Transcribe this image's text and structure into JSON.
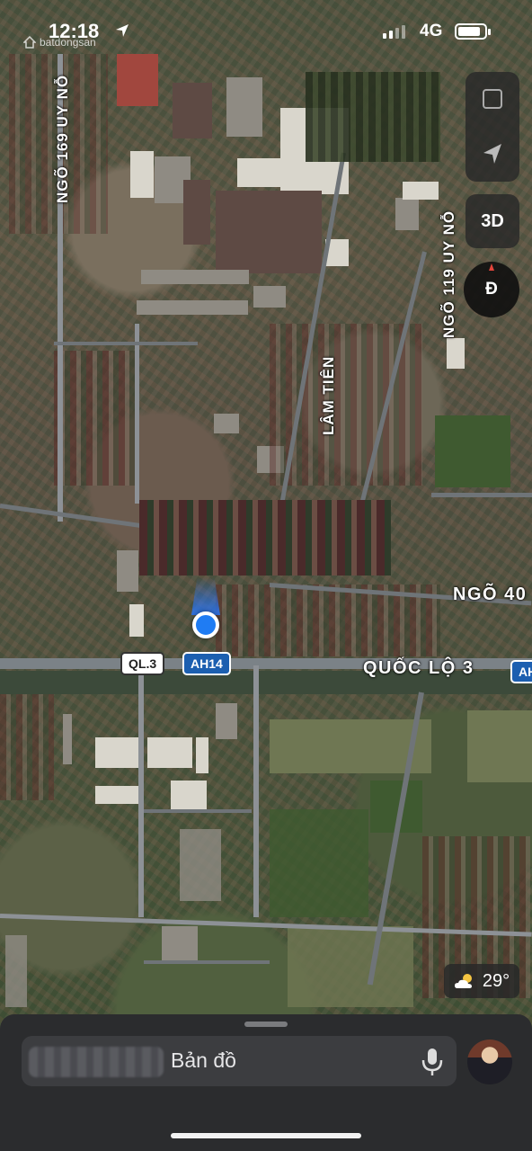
{
  "status_bar": {
    "time": "12:18",
    "network": "4G",
    "battery_level": 0.85,
    "watermark": "batdongsan"
  },
  "map": {
    "street_labels": {
      "ngo_169": "NGÕ 169 UY NỖ",
      "ngo_119": "NGÕ 119 UY NỖ",
      "lam_tien": "LÂM TIÊN",
      "ngo_40": "NGÕ 40",
      "quoc_lo_3": "QUỐC LỘ 3"
    },
    "shields": {
      "ql3": "QL.3",
      "ah14": "AH14",
      "ah_edge": "AH"
    },
    "colors": {
      "location_blue": "#1f7cf3",
      "shield_blue": "#1c5fb0"
    }
  },
  "controls": {
    "view_3d_label": "3D",
    "compass_label": "Đ",
    "weather_temp": "29°",
    "weather_icon": "partly-cloudy-icon"
  },
  "sheet": {
    "search_text": "Bản đồ",
    "mic_icon": "microphone-icon"
  }
}
